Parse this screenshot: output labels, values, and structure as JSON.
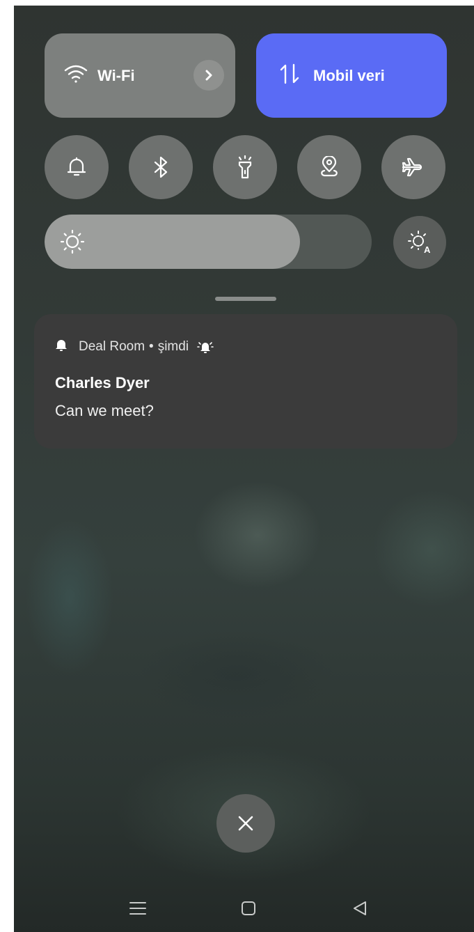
{
  "quick_settings": {
    "wifi": {
      "label": "Wi-Fi",
      "icon": "wifi-icon"
    },
    "mobile_data": {
      "label": "Mobil veri",
      "icon": "data-arrows-icon"
    },
    "toggles": [
      {
        "name": "sound",
        "icon": "bell-icon"
      },
      {
        "name": "bluetooth",
        "icon": "bluetooth-icon"
      },
      {
        "name": "flashlight",
        "icon": "flashlight-icon"
      },
      {
        "name": "location",
        "icon": "location-icon"
      },
      {
        "name": "airplane",
        "icon": "airplane-icon"
      }
    ],
    "brightness_level": 0.78,
    "colors": {
      "tile_inactive": "#7d807e",
      "tile_active": "#5a6bf5",
      "toggle_bg": "#6e716f"
    }
  },
  "notification": {
    "app": "Deal Room",
    "separator": "•",
    "time": "şimdi",
    "title": "Charles Dyer",
    "body": "Can we meet?"
  },
  "nav": [
    "menu-icon",
    "home-icon",
    "back-icon"
  ]
}
